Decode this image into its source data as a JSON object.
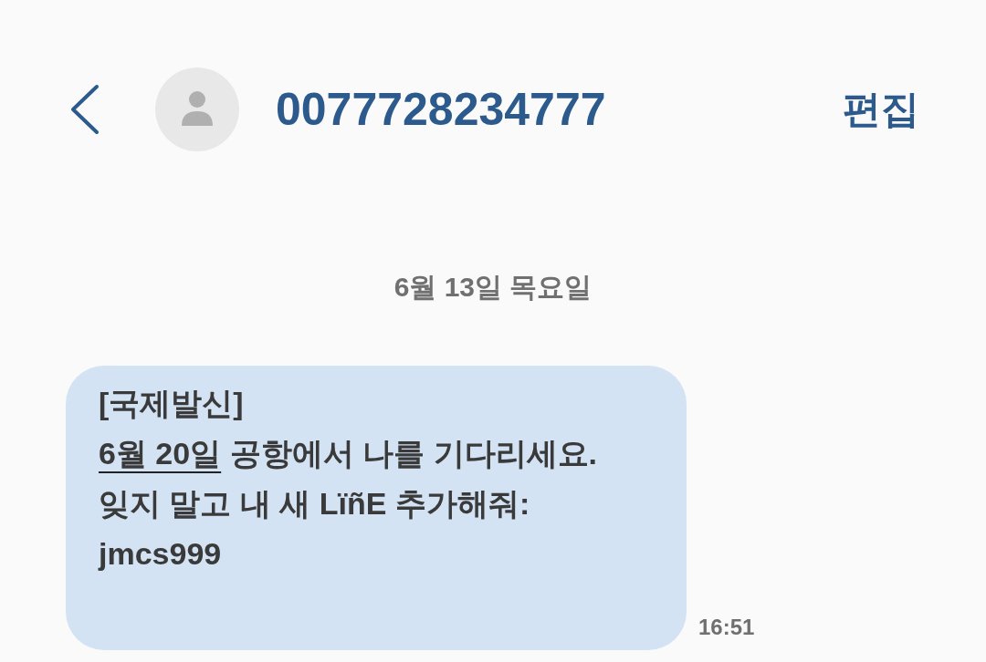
{
  "header": {
    "title": "0077728234777",
    "action": "편집"
  },
  "date_separator": "6월 13일 목요일",
  "messages": [
    {
      "segments": [
        {
          "kind": "text",
          "text": "[국제발신]\n"
        },
        {
          "kind": "link",
          "text": "6월 20일"
        },
        {
          "kind": "text",
          "text": " 공항에서 나를 기다리세요.\n잊지 말고 내 새 LïñE 추가해줘:\njmcs999"
        }
      ],
      "time": "16:51"
    }
  ]
}
